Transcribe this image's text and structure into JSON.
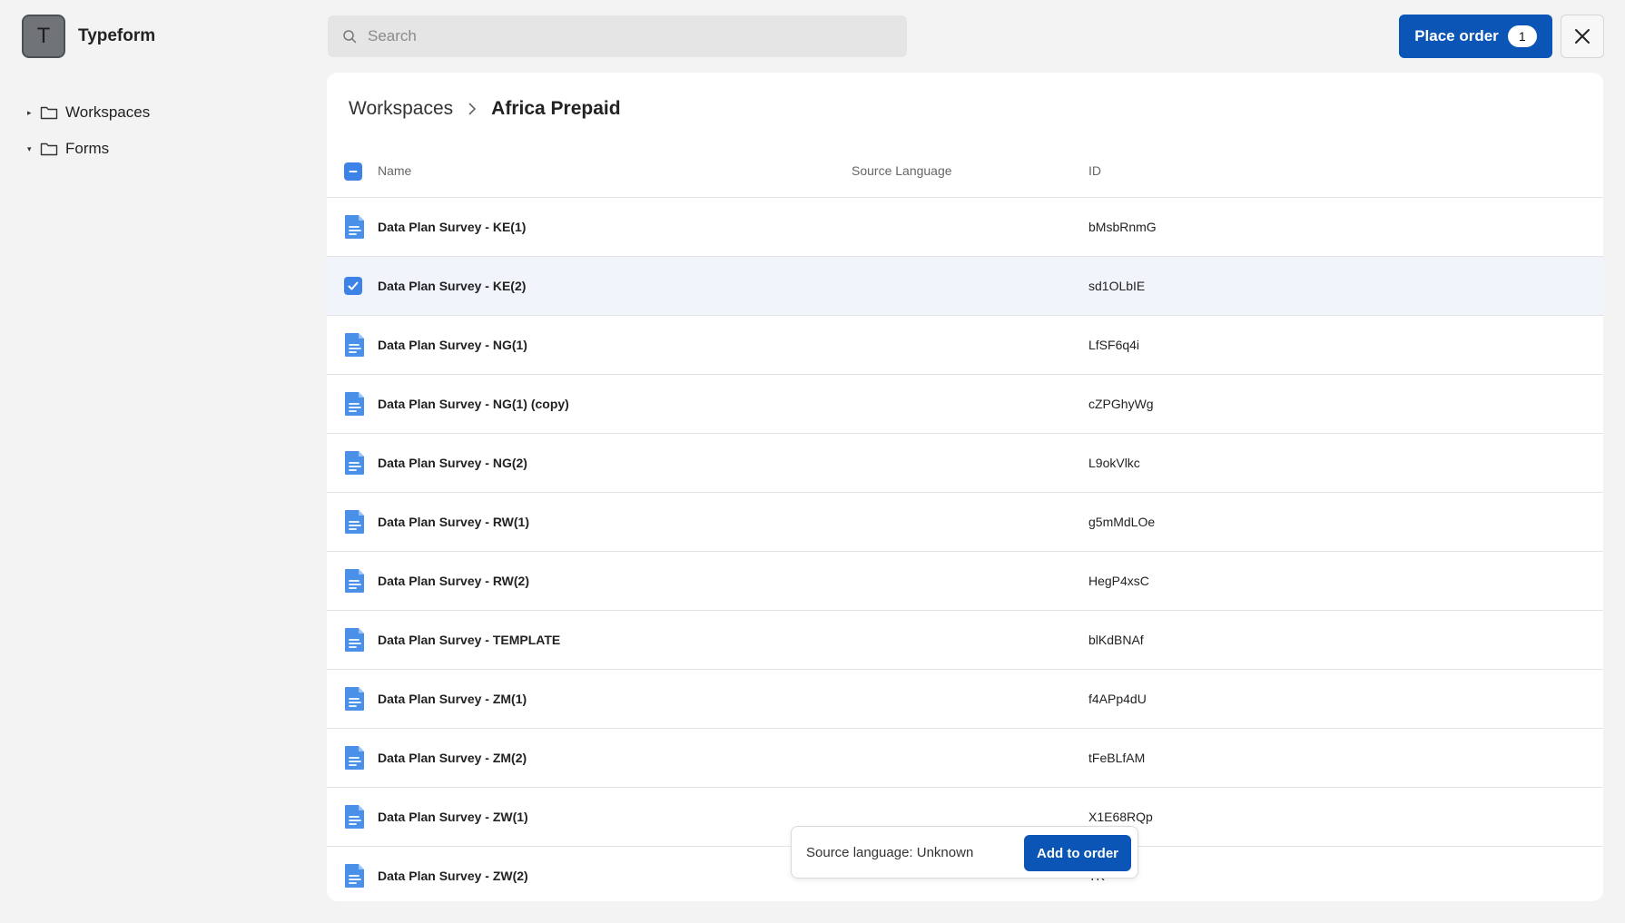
{
  "app": {
    "avatar_letter": "T",
    "name": "Typeform"
  },
  "sidebar": {
    "items": [
      {
        "label": "Workspaces",
        "caret": "▸"
      },
      {
        "label": "Forms",
        "caret": "▾"
      }
    ]
  },
  "search": {
    "placeholder": "Search"
  },
  "header": {
    "place_order_label": "Place order",
    "order_count": "1"
  },
  "breadcrumb": {
    "root": "Workspaces",
    "current": "Africa Prepaid"
  },
  "table": {
    "columns": {
      "name": "Name",
      "source_language": "Source Language",
      "id": "ID"
    },
    "rows": [
      {
        "name": "Data Plan Survey - KE(1)",
        "id": "bMsbRnmG",
        "selected": false
      },
      {
        "name": "Data Plan Survey - KE(2)",
        "id": "sd1OLbIE",
        "selected": true
      },
      {
        "name": "Data Plan Survey - NG(1)",
        "id": "LfSF6q4i",
        "selected": false
      },
      {
        "name": "Data Plan Survey - NG(1) (copy)",
        "id": "cZPGhyWg",
        "selected": false
      },
      {
        "name": "Data Plan Survey - NG(2)",
        "id": "L9okVlkc",
        "selected": false
      },
      {
        "name": "Data Plan Survey - RW(1)",
        "id": "g5mMdLOe",
        "selected": false
      },
      {
        "name": "Data Plan Survey - RW(2)",
        "id": "HegP4xsC",
        "selected": false
      },
      {
        "name": "Data Plan Survey - TEMPLATE",
        "id": "blKdBNAf",
        "selected": false
      },
      {
        "name": "Data Plan Survey - ZM(1)",
        "id": "f4APp4dU",
        "selected": false
      },
      {
        "name": "Data Plan Survey - ZM(2)",
        "id": "tFeBLfAM",
        "selected": false
      },
      {
        "name": "Data Plan Survey - ZW(1)",
        "id": "X1E68RQp",
        "selected": false
      },
      {
        "name": "Data Plan Survey - ZW(2)",
        "id": "TK",
        "selected": false
      }
    ]
  },
  "popover": {
    "text": "Source language: Unknown",
    "button_label": "Add to order"
  },
  "colors": {
    "accent": "#0a55b5",
    "checkbox": "#3d82e6",
    "file_icon": "#4a90e8",
    "selected_row": "#f1f5fb"
  }
}
